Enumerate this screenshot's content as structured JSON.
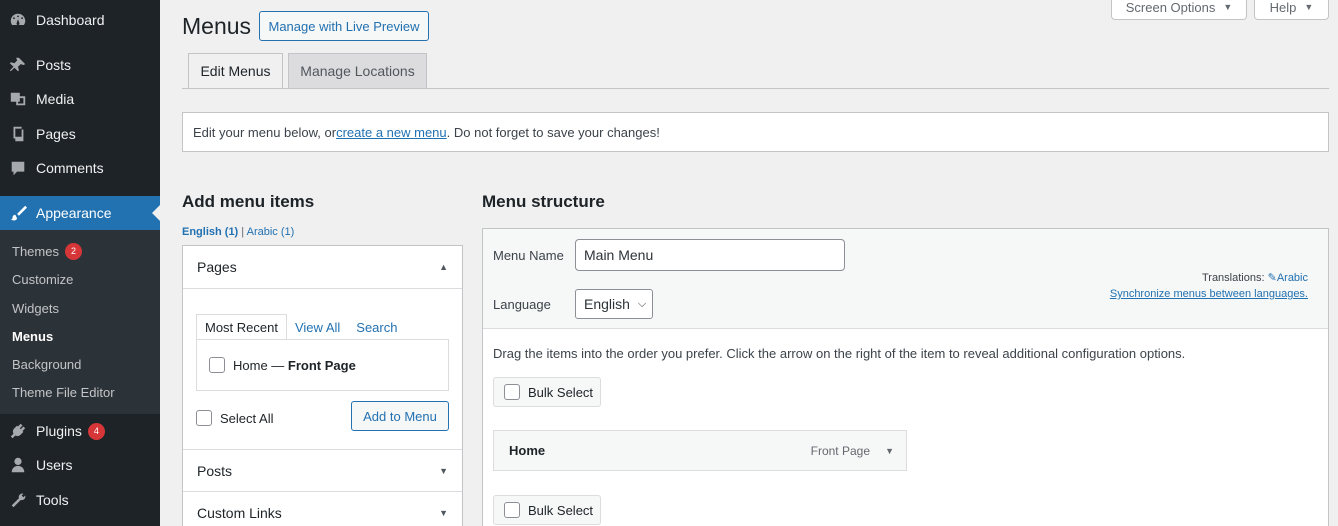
{
  "sidebar": {
    "items": [
      {
        "label": "Dashboard",
        "icon": "dashboard-icon"
      },
      {
        "label": "Posts",
        "icon": "pin-icon"
      },
      {
        "label": "Media",
        "icon": "media-icon"
      },
      {
        "label": "Pages",
        "icon": "pages-icon"
      },
      {
        "label": "Comments",
        "icon": "comments-icon"
      },
      {
        "label": "Appearance",
        "icon": "brush-icon"
      },
      {
        "label": "Plugins",
        "icon": "plugin-icon",
        "badge": "4"
      },
      {
        "label": "Users",
        "icon": "users-icon"
      },
      {
        "label": "Tools",
        "icon": "wrench-icon"
      }
    ],
    "submenu": [
      {
        "label": "Themes",
        "badge": "2"
      },
      {
        "label": "Customize"
      },
      {
        "label": "Widgets"
      },
      {
        "label": "Menus"
      },
      {
        "label": "Background"
      },
      {
        "label": "Theme File Editor"
      }
    ],
    "accent": "#2271b1"
  },
  "header": {
    "title": "Menus",
    "live_preview": "Manage with Live Preview",
    "screen_options": "Screen Options",
    "help": "Help"
  },
  "tabs": [
    "Edit Menus",
    "Manage Locations"
  ],
  "notice": {
    "before": "Edit your menu below, or ",
    "link": "create a new menu",
    "after": ". Do not forget to save your changes!"
  },
  "add_items": {
    "title": "Add menu items",
    "lang_active": "English (1)",
    "lang_sep": " | ",
    "lang_other": "Arabic (1)",
    "pages": {
      "title": "Pages",
      "tabs": [
        "Most Recent",
        "View All",
        "Search"
      ],
      "item_prefix": "Home — ",
      "item_bold": "Front Page",
      "select_all": "Select All",
      "add_button": "Add to Menu"
    },
    "posts_title": "Posts",
    "custom_links_title": "Custom Links"
  },
  "structure": {
    "title": "Menu structure",
    "menu_name_label": "Menu Name",
    "menu_name_value": "Main Menu",
    "language_label": "Language",
    "language_value": "English",
    "translations_label": "Translations:",
    "translations_link": "Arabic",
    "sync_link": "Synchronize menus between languages.",
    "drag_hint": "Drag the items into the order you prefer. Click the arrow on the right of the item to reveal additional configuration options.",
    "bulk_select": "Bulk Select",
    "menu_item": {
      "title": "Home",
      "type": "Front Page"
    }
  }
}
